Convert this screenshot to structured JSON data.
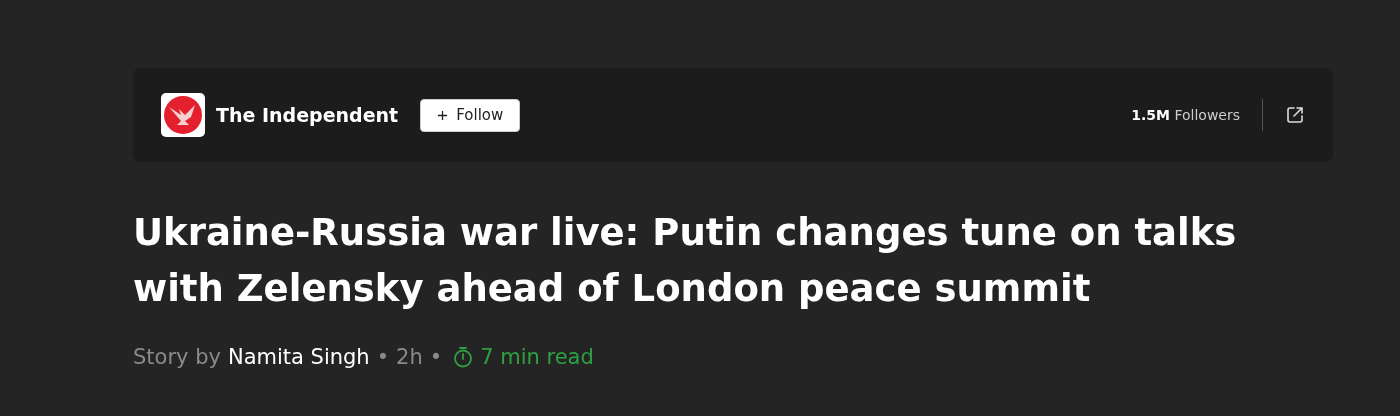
{
  "publisher": {
    "name": "The Independent",
    "follow_button": "Follow",
    "followers": "**1.5M** Followers"
  },
  "headline": "Ukraine-Russia war live: Putin changes tune on talks with Zelensky ahead of London peace summit",
  "byline": {
    "prefix": "Story by",
    "author": "Namita Singh",
    "separator_1": "•",
    "age": "2h",
    "separator_2": "•",
    "read_time": "7 min read"
  }
}
